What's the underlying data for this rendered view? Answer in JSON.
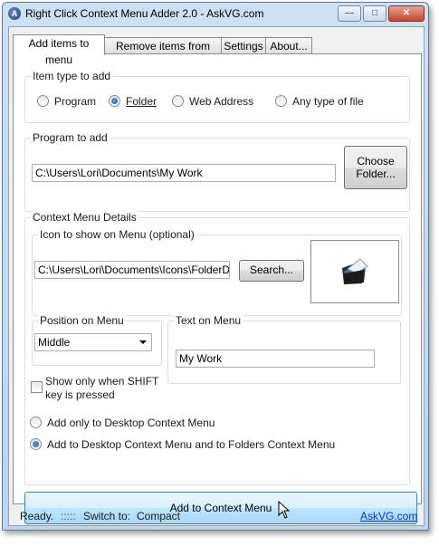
{
  "window": {
    "title": "Right Click Context Menu Adder 2.0  -  AskVG.com",
    "app_icon": "askvg-logo-icon"
  },
  "tabs": [
    {
      "label": "Add items to menu",
      "active": true
    },
    {
      "label": "Remove items from menu",
      "active": false
    },
    {
      "label": "Settings",
      "active": false
    },
    {
      "label": "About...",
      "active": false
    }
  ],
  "item_type": {
    "label": "Item type to add",
    "options": [
      {
        "label": "Program",
        "selected": false
      },
      {
        "label": "Folder",
        "selected": true
      },
      {
        "label": "Web Address",
        "selected": false
      },
      {
        "label": "Any type of file",
        "selected": false
      }
    ]
  },
  "program": {
    "label": "Program to add",
    "path": "C:\\Users\\Lori\\Documents\\My Work",
    "choose_line1": "Choose",
    "choose_line2": "Folder..."
  },
  "context_details": {
    "label": "Context Menu Details",
    "icon_group_label": "Icon to show on Menu (optional)",
    "icon_path": "C:\\Users\\Lori\\Documents\\Icons\\FolderDocu",
    "search_label": "Search...",
    "preview_icon": "folder-documents-icon",
    "position_label": "Position on Menu",
    "position_value": "Middle",
    "text_label": "Text on Menu",
    "text_value": "My Work",
    "shift_line1": "Show only when SHIFT",
    "shift_line2": "key is pressed",
    "shift_checked": false,
    "desktop_only_label": "Add only to Desktop Context Menu",
    "desktop_and_folders_label": "Add to Desktop Context Menu and to Folders Context Menu",
    "desktop_mode": "desktop_and_folders"
  },
  "action": {
    "add_label": "Add to Context Menu"
  },
  "status": {
    "ready": "Ready.",
    "grip": ":::::",
    "switch_to": "Switch to:",
    "compact": "Compact",
    "link": "AskVG.com"
  },
  "colors": {
    "link": "#0033cc",
    "primary_button": "#bee6fd",
    "window_frame": "#bcd4ec"
  }
}
